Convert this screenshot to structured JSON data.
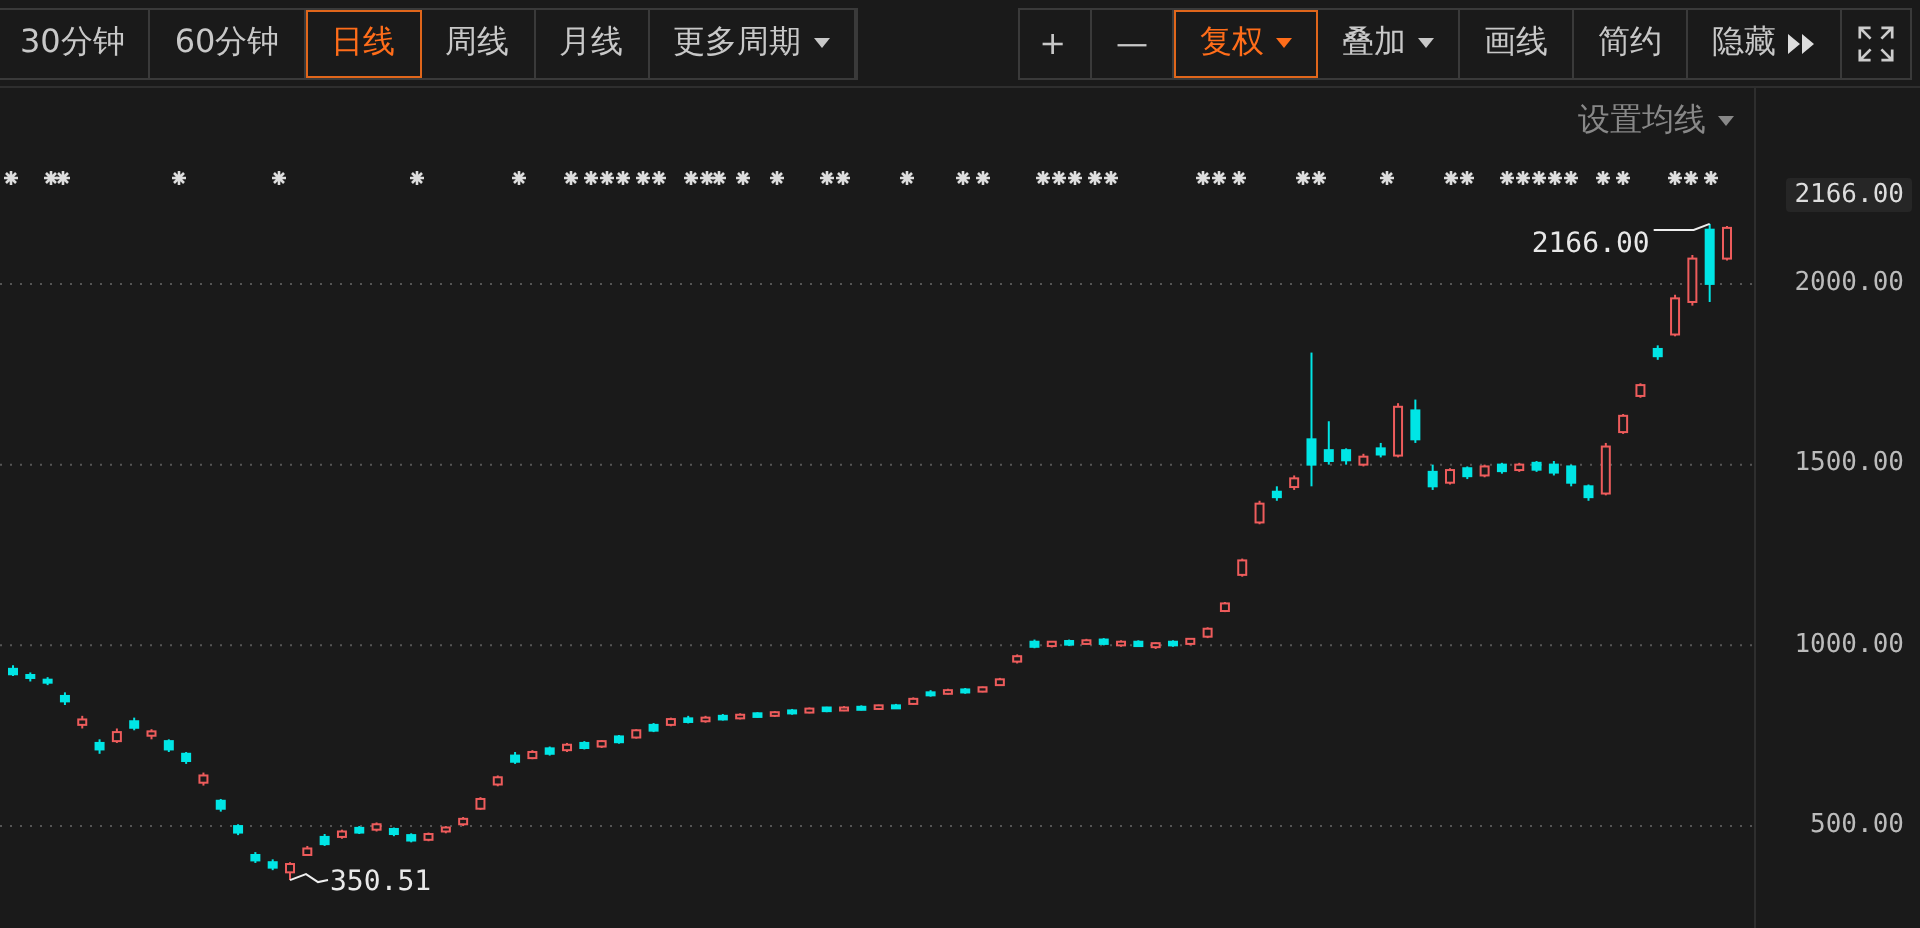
{
  "toolbar": {
    "periods": [
      {
        "label": "30分钟",
        "selected": false,
        "dropdown": false
      },
      {
        "label": "60分钟",
        "selected": false,
        "dropdown": false
      },
      {
        "label": "日线",
        "selected": true,
        "dropdown": false
      },
      {
        "label": "周线",
        "selected": false,
        "dropdown": false
      },
      {
        "label": "月线",
        "selected": false,
        "dropdown": false
      },
      {
        "label": "更多周期",
        "selected": false,
        "dropdown": true
      }
    ],
    "tools": [
      {
        "kind": "text",
        "label": "+",
        "selected": false,
        "dropdown": false
      },
      {
        "kind": "text",
        "label": "—",
        "selected": false,
        "dropdown": false
      },
      {
        "kind": "text",
        "label": "复权",
        "selected": true,
        "dropdown": true
      },
      {
        "kind": "text",
        "label": "叠加",
        "selected": false,
        "dropdown": true
      },
      {
        "kind": "text",
        "label": "画线",
        "selected": false,
        "dropdown": false
      },
      {
        "kind": "text",
        "label": "简约",
        "selected": false,
        "dropdown": false
      },
      {
        "kind": "expand",
        "label": "隐藏",
        "selected": false,
        "dropdown": false
      },
      {
        "kind": "fullscreen",
        "selected": false,
        "dropdown": false
      }
    ]
  },
  "ma_settings": {
    "label": "设置均线"
  },
  "current_price": "2166.00",
  "chart_data": {
    "type": "candlestick",
    "grid": true,
    "ohlc": [
      [
        935,
        945,
        915,
        920
      ],
      [
        918,
        925,
        900,
        910
      ],
      [
        905,
        912,
        890,
        898
      ],
      [
        860,
        870,
        835,
        845
      ],
      [
        780,
        805,
        770,
        795
      ],
      [
        730,
        740,
        700,
        712
      ],
      [
        735,
        770,
        730,
        760
      ],
      [
        790,
        800,
        765,
        772
      ],
      [
        750,
        768,
        740,
        762
      ],
      [
        735,
        740,
        705,
        712
      ],
      [
        700,
        705,
        672,
        680
      ],
      [
        620,
        648,
        612,
        640
      ],
      [
        570,
        575,
        540,
        548
      ],
      [
        500,
        505,
        475,
        482
      ],
      [
        420,
        428,
        398,
        405
      ],
      [
        400,
        408,
        378,
        385
      ],
      [
        372,
        400,
        350.51,
        395
      ],
      [
        420,
        445,
        418,
        438
      ],
      [
        470,
        478,
        445,
        450
      ],
      [
        470,
        490,
        465,
        485
      ],
      [
        495,
        500,
        478,
        482
      ],
      [
        490,
        510,
        485,
        505
      ],
      [
        492,
        496,
        472,
        478
      ],
      [
        475,
        480,
        455,
        460
      ],
      [
        462,
        482,
        458,
        478
      ],
      [
        485,
        500,
        480,
        496
      ],
      [
        505,
        525,
        500,
        520
      ],
      [
        548,
        580,
        545,
        575
      ],
      [
        615,
        640,
        610,
        635
      ],
      [
        695,
        705,
        672,
        678
      ],
      [
        688,
        710,
        685,
        705
      ],
      [
        715,
        720,
        695,
        700
      ],
      [
        710,
        730,
        705,
        725
      ],
      [
        730,
        735,
        712,
        716
      ],
      [
        720,
        738,
        716,
        735
      ],
      [
        748,
        752,
        728,
        732
      ],
      [
        745,
        768,
        742,
        765
      ],
      [
        780,
        785,
        760,
        764
      ],
      [
        780,
        800,
        776,
        796
      ],
      [
        798,
        805,
        784,
        788
      ],
      [
        790,
        805,
        786,
        800
      ],
      [
        805,
        810,
        792,
        795
      ],
      [
        798,
        812,
        795,
        808
      ],
      [
        812,
        815,
        800,
        802
      ],
      [
        805,
        818,
        802,
        815
      ],
      [
        820,
        824,
        808,
        812
      ],
      [
        814,
        828,
        812,
        825
      ],
      [
        828,
        830,
        815,
        818
      ],
      [
        820,
        832,
        818,
        828
      ],
      [
        830,
        834,
        820,
        822
      ],
      [
        824,
        836,
        822,
        834
      ],
      [
        834,
        838,
        824,
        826
      ],
      [
        838,
        856,
        836,
        852
      ],
      [
        870,
        876,
        858,
        862
      ],
      [
        866,
        880,
        864,
        876
      ],
      [
        878,
        882,
        866,
        870
      ],
      [
        872,
        886,
        870,
        884
      ],
      [
        890,
        910,
        888,
        906
      ],
      [
        955,
        975,
        950,
        970
      ],
      [
        1010,
        1016,
        992,
        996
      ],
      [
        998,
        1012,
        994,
        1010
      ],
      [
        1012,
        1016,
        998,
        1002
      ],
      [
        1004,
        1018,
        1002,
        1014
      ],
      [
        1016,
        1020,
        1000,
        1004
      ],
      [
        1000,
        1014,
        996,
        1010
      ],
      [
        1010,
        1014,
        996,
        998
      ],
      [
        995,
        1008,
        990,
        1006
      ],
      [
        1010,
        1014,
        996,
        1000
      ],
      [
        1004,
        1020,
        1000,
        1018
      ],
      [
        1024,
        1050,
        1020,
        1046
      ],
      [
        1095,
        1120,
        1092,
        1116
      ],
      [
        1195,
        1240,
        1190,
        1235
      ],
      [
        1340,
        1400,
        1335,
        1392
      ],
      [
        1425,
        1440,
        1400,
        1410
      ],
      [
        1438,
        1470,
        1430,
        1462
      ],
      [
        1570,
        1810,
        1440,
        1500
      ],
      [
        1540,
        1620,
        1500,
        1510
      ],
      [
        1540,
        1545,
        1500,
        1512
      ],
      [
        1500,
        1530,
        1495,
        1522
      ],
      [
        1545,
        1560,
        1520,
        1528
      ],
      [
        1525,
        1670,
        1520,
        1660
      ],
      [
        1650,
        1680,
        1560,
        1570
      ],
      [
        1480,
        1500,
        1430,
        1440
      ],
      [
        1450,
        1490,
        1445,
        1485
      ],
      [
        1490,
        1495,
        1460,
        1468
      ],
      [
        1470,
        1500,
        1465,
        1495
      ],
      [
        1500,
        1505,
        1475,
        1482
      ],
      [
        1485,
        1505,
        1480,
        1500
      ],
      [
        1505,
        1510,
        1480,
        1486
      ],
      [
        1500,
        1510,
        1470,
        1478
      ],
      [
        1495,
        1500,
        1440,
        1450
      ],
      [
        1440,
        1445,
        1400,
        1410
      ],
      [
        1420,
        1560,
        1415,
        1550
      ],
      [
        1590,
        1640,
        1585,
        1635
      ],
      [
        1690,
        1725,
        1685,
        1720
      ],
      [
        1820,
        1830,
        1790,
        1800
      ],
      [
        1860,
        1970,
        1855,
        1960
      ],
      [
        1950,
        2080,
        1940,
        2070
      ],
      [
        2150,
        2166,
        1950,
        2000
      ],
      [
        2070,
        2160,
        2065,
        2155
      ]
    ],
    "ylim": [
      218,
      2542
    ],
    "yticks": [
      {
        "value": 2000,
        "label": "2000.00"
      },
      {
        "value": 1500,
        "label": "1500.00"
      },
      {
        "value": 1000,
        "label": "1000.00"
      },
      {
        "value": 500,
        "label": "500.00"
      }
    ],
    "annotations": [
      "2166.00",
      "350.51"
    ]
  }
}
